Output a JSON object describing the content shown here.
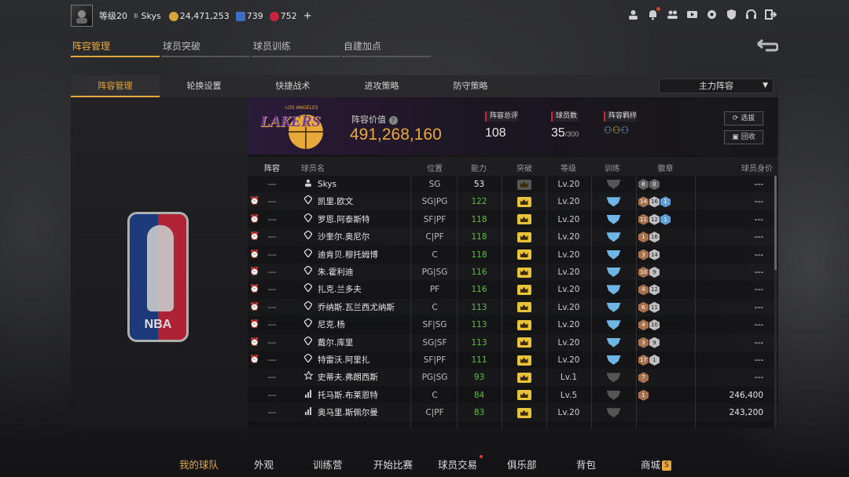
{
  "topbar": {
    "level": "等级20",
    "rank_mark": "Ⅲ",
    "username": "Skys",
    "coins": "24,471,253",
    "stars": "739",
    "gems": "752",
    "add": "+"
  },
  "main_tabs": [
    "阵容管理",
    "球员突破",
    "球员训练",
    "自建加点"
  ],
  "sub_tabs": [
    "阵容管理",
    "轮换设置",
    "快捷战术",
    "进攻策略",
    "防守策略"
  ],
  "lineup_select": "主力阵容",
  "team": {
    "logo_text": "LAKERS",
    "logo_sub": "LOS ANGELES",
    "value_label": "阵容价值",
    "value": "491,268,160",
    "rating_label": "阵容总评",
    "rating": "108",
    "players_label": "球员数",
    "players": "35",
    "players_max": "/300",
    "bonds_label": "阵容羁绊",
    "select_btn": "选拔",
    "recycle_btn": "回收"
  },
  "nba_logo_text": "NBA",
  "table": {
    "headers": [
      "阵容",
      "球员名",
      "位置",
      "能力",
      "突破",
      "等级",
      "训练",
      "徽章",
      "球员身价"
    ],
    "rows": [
      {
        "clock": false,
        "lineup": "---",
        "icon": "person",
        "name": "Skys",
        "pos": "SG",
        "rating": "53",
        "rating_green": false,
        "break": "gray",
        "level": "Lv.20",
        "train": "gray",
        "badges": [
          [
            "8",
            "b-dk"
          ],
          [
            "0",
            "b-dk"
          ]
        ],
        "value": "---"
      },
      {
        "clock": true,
        "lineup": "---",
        "icon": "diamond",
        "name": "凯里.欧文",
        "pos": "SG|PG",
        "rating": "122",
        "rating_green": true,
        "break": "gold",
        "level": "Lv.20",
        "train": "blue",
        "badges": [
          [
            "14",
            "b-br"
          ],
          [
            "16",
            "b-si"
          ],
          [
            "1",
            "b-bl"
          ]
        ],
        "value": "---"
      },
      {
        "clock": true,
        "lineup": "---",
        "icon": "diamond",
        "name": "罗恩.阿泰斯特",
        "pos": "SF|PF",
        "rating": "118",
        "rating_green": true,
        "break": "gold",
        "level": "Lv.20",
        "train": "blue",
        "badges": [
          [
            "11",
            "b-br"
          ],
          [
            "12",
            "b-si"
          ],
          [
            "1",
            "b-bl"
          ]
        ],
        "value": "---"
      },
      {
        "clock": true,
        "lineup": "---",
        "icon": "diamond",
        "name": "沙奎尔.奥尼尔",
        "pos": "C|PF",
        "rating": "118",
        "rating_green": true,
        "break": "gold",
        "level": "Lv.20",
        "train": "blue",
        "badges": [
          [
            "1",
            "b-br"
          ],
          [
            "16",
            "b-si"
          ]
        ],
        "value": "---"
      },
      {
        "clock": true,
        "lineup": "---",
        "icon": "diamond",
        "name": "迪肯贝.穆托姆博",
        "pos": "C",
        "rating": "118",
        "rating_green": true,
        "break": "gold",
        "level": "Lv.20",
        "train": "blue",
        "badges": [
          [
            "3",
            "b-br"
          ],
          [
            "14",
            "b-si"
          ]
        ],
        "value": "---"
      },
      {
        "clock": true,
        "lineup": "---",
        "icon": "diamond",
        "name": "朱.霍利迪",
        "pos": "PG|SG",
        "rating": "116",
        "rating_green": true,
        "break": "gold",
        "level": "Lv.20",
        "train": "blue",
        "badges": [
          [
            "10",
            "b-br"
          ],
          [
            "9",
            "b-si"
          ]
        ],
        "value": "---"
      },
      {
        "clock": true,
        "lineup": "---",
        "icon": "diamond",
        "name": "扎克.兰多夫",
        "pos": "PF",
        "rating": "116",
        "rating_green": true,
        "break": "gold",
        "level": "Lv.20",
        "train": "blue",
        "badges": [
          [
            "4",
            "b-br"
          ],
          [
            "12",
            "b-si"
          ]
        ],
        "value": "---"
      },
      {
        "clock": true,
        "lineup": "---",
        "icon": "diamond",
        "name": "乔纳斯.瓦兰西尤纳斯",
        "pos": "C",
        "rating": "113",
        "rating_green": true,
        "break": "gold",
        "level": "Lv.20",
        "train": "blue",
        "badges": [
          [
            "6",
            "b-br"
          ],
          [
            "11",
            "b-si"
          ]
        ],
        "value": "---"
      },
      {
        "clock": true,
        "lineup": "---",
        "icon": "diamond",
        "name": "尼克.杨",
        "pos": "SF|SG",
        "rating": "113",
        "rating_green": true,
        "break": "gold",
        "level": "Lv.20",
        "train": "blue",
        "badges": [
          [
            "4",
            "b-br"
          ],
          [
            "10",
            "b-si"
          ]
        ],
        "value": "---"
      },
      {
        "clock": true,
        "lineup": "---",
        "icon": "diamond",
        "name": "戴尔.库里",
        "pos": "SG|SF",
        "rating": "113",
        "rating_green": true,
        "break": "gold",
        "level": "Lv.20",
        "train": "blue",
        "badges": [
          [
            "3",
            "b-br"
          ],
          [
            "9",
            "b-si"
          ]
        ],
        "value": "---"
      },
      {
        "clock": true,
        "lineup": "---",
        "icon": "diamond",
        "name": "特雷沃.阿里扎",
        "pos": "SF|PF",
        "rating": "111",
        "rating_green": true,
        "break": "gold",
        "level": "Lv.20",
        "train": "blue",
        "badges": [
          [
            "17",
            "b-br"
          ],
          [
            "1",
            "b-si"
          ]
        ],
        "value": "---"
      },
      {
        "clock": false,
        "lineup": "---",
        "icon": "star",
        "name": "史蒂夫.弗朗西斯",
        "pos": "PG|SG",
        "rating": "93",
        "rating_green": true,
        "break": "gold",
        "level": "Lv.1",
        "train": "gray",
        "badges": [
          [
            "7",
            "b-br"
          ]
        ],
        "value": "---"
      },
      {
        "clock": false,
        "lineup": "---",
        "icon": "bars",
        "name": "托马斯.布莱恩特",
        "pos": "C",
        "rating": "84",
        "rating_green": true,
        "break": "gold",
        "level": "Lv.5",
        "train": "gray",
        "badges": [
          [
            "1",
            "b-br"
          ]
        ],
        "value": "246,400"
      },
      {
        "clock": false,
        "lineup": "---",
        "icon": "bars",
        "name": "奥马里.斯佩尔曼",
        "pos": "C|PF",
        "rating": "83",
        "rating_green": true,
        "break": "gold",
        "level": "Lv.20",
        "train": "gray",
        "badges": [],
        "value": "243,200"
      }
    ]
  },
  "bottom_nav": [
    "我的球队",
    "外观",
    "训练营",
    "开始比赛",
    "球员交易",
    "俱乐部",
    "背包",
    "商城"
  ],
  "colors": {
    "accent": "#e8a93a",
    "green": "#5fbf3a",
    "red": "#c8243a",
    "blue": "#6fb6e6"
  }
}
